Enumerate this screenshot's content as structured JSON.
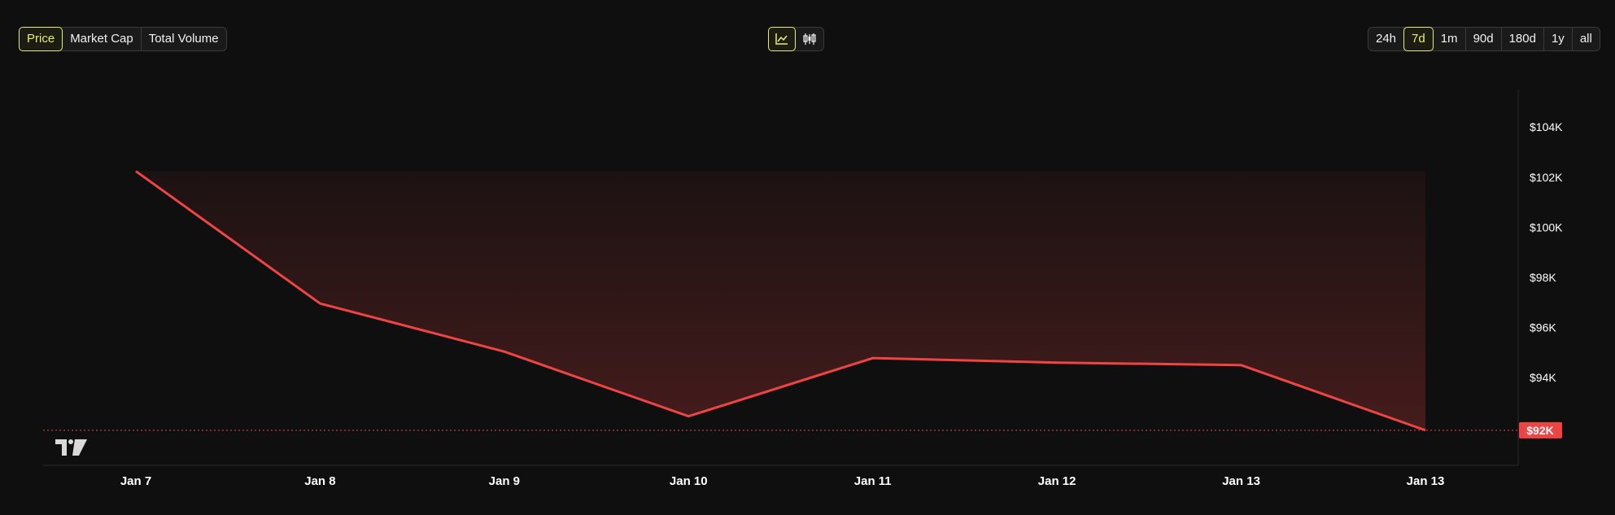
{
  "metric_tabs": [
    {
      "label": "Price",
      "active": true
    },
    {
      "label": "Market Cap",
      "active": false
    },
    {
      "label": "Total Volume",
      "active": false
    }
  ],
  "chart_type_buttons": [
    {
      "icon": "line-chart-icon",
      "active": true
    },
    {
      "icon": "candlestick-icon",
      "active": false
    }
  ],
  "range_tabs": [
    {
      "label": "24h",
      "active": false
    },
    {
      "label": "7d",
      "active": true
    },
    {
      "label": "1m",
      "active": false
    },
    {
      "label": "90d",
      "active": false
    },
    {
      "label": "180d",
      "active": false
    },
    {
      "label": "1y",
      "active": false
    },
    {
      "label": "all",
      "active": false
    }
  ],
  "accent_color": "#e3f06a",
  "line_color": "#ef4444",
  "chart_data": {
    "type": "area",
    "x": [
      "Jan 7",
      "Jan 8",
      "Jan 9",
      "Jan 10",
      "Jan 11",
      "Jan 12",
      "Jan 13",
      "Jan 13"
    ],
    "series": [
      {
        "values": [
          102240,
          96960,
          95040,
          92460,
          94780,
          94600,
          94500,
          91900
        ]
      }
    ],
    "y_ticks": [
      {
        "value": 104000,
        "label": "$104K"
      },
      {
        "value": 102000,
        "label": "$102K"
      },
      {
        "value": 100000,
        "label": "$100K"
      },
      {
        "value": 98000,
        "label": "$98K"
      },
      {
        "value": 96000,
        "label": "$96K"
      },
      {
        "value": 94000,
        "label": "$94K"
      },
      {
        "value": 92000,
        "label": "$92K"
      }
    ],
    "ylim": [
      90500,
      105500
    ],
    "current_price_label": "$92K",
    "current_price_value": 91900,
    "grid": false
  }
}
